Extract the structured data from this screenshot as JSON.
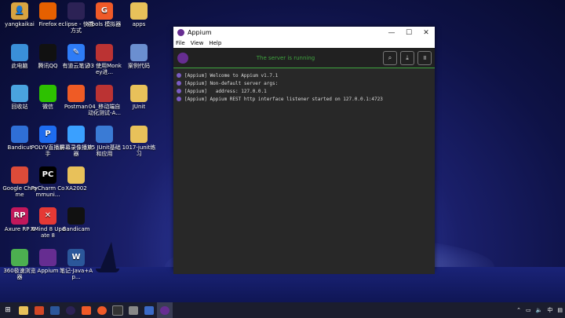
{
  "desktop_icons": [
    {
      "label": "yangkaikai",
      "color": "#d9a441",
      "glyph": "👤",
      "name": "user-folder-icon"
    },
    {
      "label": "Firefox",
      "color": "#e66000",
      "glyph": "",
      "name": "firefox-icon"
    },
    {
      "label": "eclipse - 快捷方式",
      "color": "#2c2255",
      "glyph": "",
      "name": "eclipse-icon"
    },
    {
      "label": "iTools 模拟器",
      "color": "#f05a28",
      "glyph": "G",
      "name": "itools-icon"
    },
    {
      "label": "apps",
      "color": "#e8c15a",
      "glyph": "",
      "name": "folder-icon"
    },
    {
      "label": "此电脑",
      "color": "#3a8fd8",
      "glyph": "",
      "name": "computer-icon"
    },
    {
      "label": "腾讯QQ",
      "color": "#111111",
      "glyph": "",
      "name": "qq-icon"
    },
    {
      "label": "有道云笔记",
      "color": "#2e7cf6",
      "glyph": "✎",
      "name": "youdao-icon"
    },
    {
      "label": "03 使用Monkey进...",
      "color": "#b33",
      "glyph": "",
      "name": "video-file-icon"
    },
    {
      "label": "案例代码",
      "color": "#6b8fd0",
      "glyph": "",
      "name": "zip-folder-icon"
    },
    {
      "label": "回收站",
      "color": "#4aa3df",
      "glyph": "",
      "name": "recycle-bin-icon"
    },
    {
      "label": "微信",
      "color": "#2dc100",
      "glyph": "",
      "name": "wechat-icon"
    },
    {
      "label": "Postman",
      "color": "#ef5b25",
      "glyph": "",
      "name": "postman-icon"
    },
    {
      "label": "04_移动端自动化测试-A...",
      "color": "#b33",
      "glyph": "",
      "name": "video-file-icon"
    },
    {
      "label": "JUnit",
      "color": "#e8c15a",
      "glyph": "",
      "name": "folder-icon"
    },
    {
      "label": "Bandicut",
      "color": "#2f6fd6",
      "glyph": "",
      "name": "bandicut-icon"
    },
    {
      "label": "POLYV直播助手",
      "color": "#1e6cf0",
      "glyph": "P",
      "name": "polyv-icon"
    },
    {
      "label": "屏幕录像播放器",
      "color": "#3aa0ff",
      "glyph": "",
      "name": "recorder-icon"
    },
    {
      "label": "05 JUnit基础和应用",
      "color": "#3a7bd5",
      "glyph": "",
      "name": "video-file-icon"
    },
    {
      "label": "1017-junit练习",
      "color": "#e8c15a",
      "glyph": "",
      "name": "folder-icon"
    },
    {
      "label": "Google Chrome",
      "color": "#dd4b39",
      "glyph": "",
      "name": "chrome-icon"
    },
    {
      "label": "PyCharm Communi...",
      "color": "#000000",
      "glyph": "PC",
      "name": "pycharm-icon"
    },
    {
      "label": "XA2002",
      "color": "#e8c15a",
      "glyph": "",
      "name": "folder-icon"
    },
    {
      "label": "Axure RP 8",
      "color": "#c2185b",
      "glyph": "RP",
      "name": "axure-icon"
    },
    {
      "label": "XMind 8 Update 8",
      "color": "#e53935",
      "glyph": "✕",
      "name": "xmind-icon"
    },
    {
      "label": "Bandicam",
      "color": "#111111",
      "glyph": "",
      "name": "bandicam-icon"
    },
    {
      "label": "360极速浏览器",
      "color": "#4caf50",
      "glyph": "",
      "name": "360-browser-icon"
    },
    {
      "label": "Appium",
      "color": "#662d91",
      "glyph": "",
      "name": "appium-icon"
    },
    {
      "label": "笔记-Java+Ap...",
      "color": "#2b579a",
      "glyph": "W",
      "name": "word-doc-icon"
    }
  ],
  "window": {
    "title": "Appium",
    "menu": [
      "File",
      "View",
      "Help"
    ],
    "status": "The server is running",
    "log": [
      "[Appium] Welcome to Appium v1.7.1",
      "[Appium] Non-default server args:",
      "[Appium]   address: 127.0.0.1",
      "[Appium] Appium REST http interface listener started on 127.0.0.1:4723"
    ]
  },
  "colors": {
    "accent": "#3fa43f",
    "appium_purple": "#662d91"
  }
}
